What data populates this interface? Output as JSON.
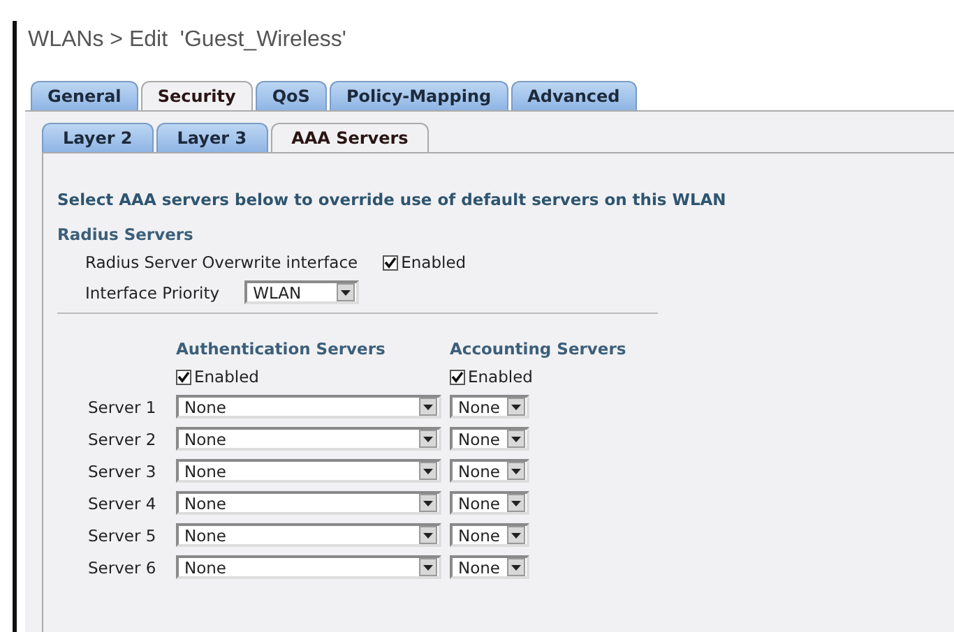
{
  "breadcrumb": "WLANs > Edit  'Guest_Wireless'",
  "tabs": [
    {
      "label": "General",
      "selected": false
    },
    {
      "label": "Security",
      "selected": true
    },
    {
      "label": "QoS",
      "selected": false
    },
    {
      "label": "Policy-Mapping",
      "selected": false
    },
    {
      "label": "Advanced",
      "selected": false
    }
  ],
  "subtabs": [
    {
      "label": "Layer 2",
      "selected": false
    },
    {
      "label": "Layer 3",
      "selected": false
    },
    {
      "label": "AAA Servers",
      "selected": true
    }
  ],
  "intro": "Select AAA servers below to override use of default servers on this WLAN",
  "section_title": "Radius Servers",
  "overwrite": {
    "label": "Radius Server Overwrite interface",
    "checkbox_label": "Enabled",
    "checked": true
  },
  "priority": {
    "label": "Interface Priority",
    "value": "WLAN"
  },
  "columns": [
    {
      "heading": "Authentication Servers",
      "enabled_label": "Enabled",
      "enabled": true
    },
    {
      "heading": "Accounting Servers",
      "enabled_label": "Enabled",
      "enabled": true
    }
  ],
  "servers": [
    {
      "label": "Server 1",
      "authentication": "None",
      "accounting": "None"
    },
    {
      "label": "Server 2",
      "authentication": "None",
      "accounting": "None"
    },
    {
      "label": "Server 3",
      "authentication": "None",
      "accounting": "None"
    },
    {
      "label": "Server 4",
      "authentication": "None",
      "accounting": "None"
    },
    {
      "label": "Server 5",
      "authentication": "None",
      "accounting": "None"
    },
    {
      "label": "Server 6",
      "authentication": "None",
      "accounting": "None"
    }
  ]
}
